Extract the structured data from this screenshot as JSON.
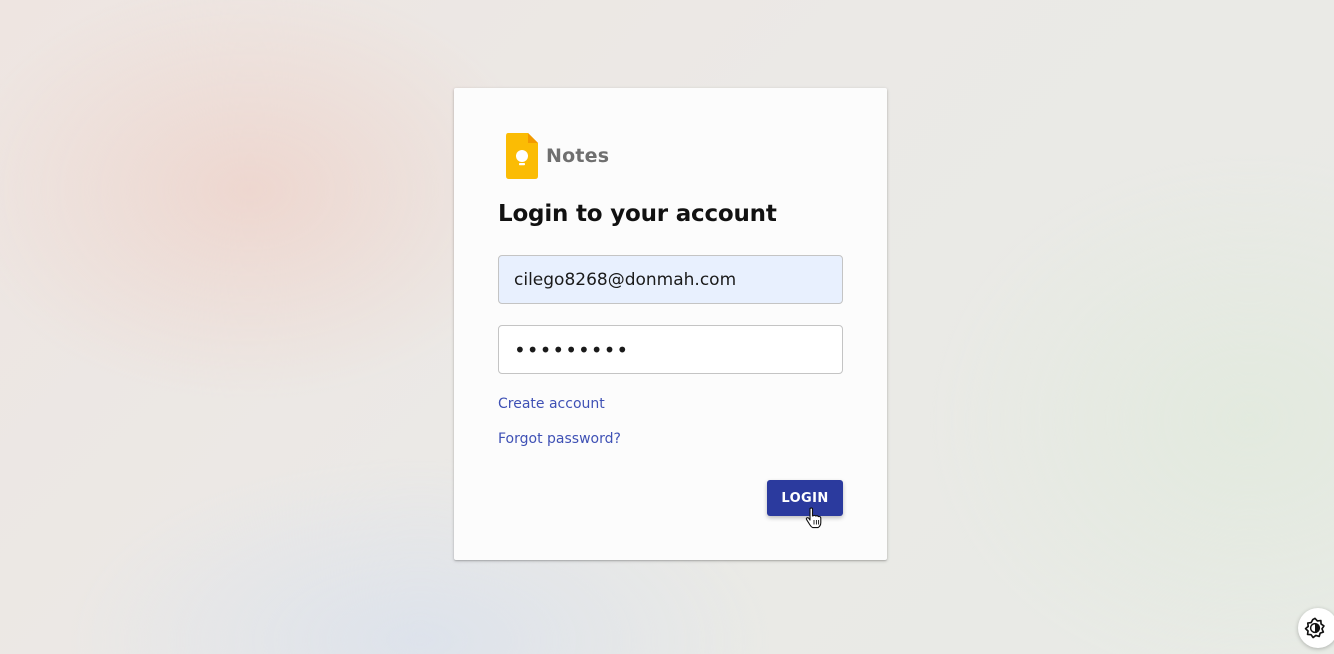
{
  "brand": {
    "name": "Notes",
    "logo_icon": "keep-bulb-logo-icon",
    "logo_color": "#fbbc04"
  },
  "login": {
    "title": "Login to your account",
    "email_value": "cilego8268@donmah.com",
    "password_value": "•••••••••",
    "create_account_label": "Create account",
    "forgot_password_label": "Forgot password?",
    "login_button_label": "LOGIN"
  },
  "colors": {
    "accent": "#3f51b5",
    "button": "#2b3a9e",
    "autofill_background": "#e8f0fe"
  },
  "floating": {
    "theme_toggle_icon": "brightness-icon"
  }
}
